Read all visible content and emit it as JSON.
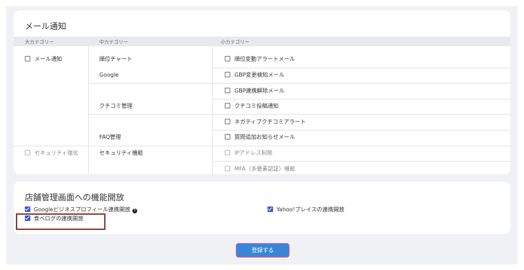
{
  "email_section": {
    "title": "メール通知",
    "headers": {
      "large": "大カテゴリー",
      "middle": "中カテゴリー",
      "small": "小カテゴリー"
    },
    "rows": [
      {
        "large": "メール通知",
        "middle": "順位チャート",
        "small": "順位変動アラートメール"
      },
      {
        "middle": "Google",
        "small": "GBP変更検知メール"
      },
      {
        "small": "GBP連携解除メール"
      },
      {
        "middle": "クチコミ管理",
        "small": "クチコミ投稿通知"
      },
      {
        "small": "ネガティブクチコミアラート"
      },
      {
        "middle": "FAQ管理",
        "small": "質問追加お知らせメール"
      },
      {
        "large": "セキュリティ強化",
        "middle": "セキュリティ機能",
        "small": "IPアドレス制限"
      },
      {
        "small": "MFA（多要素認証）機能"
      }
    ]
  },
  "store_section": {
    "title": "店舗管理画面への機能開放",
    "options": [
      {
        "label": "Googleビジネスプロフィール連携開放",
        "checked": true
      },
      {
        "label": "Yahoo!プレイスの連携開放",
        "checked": true
      },
      {
        "label": "食べログの連携開放",
        "checked": true
      }
    ]
  },
  "submit_label": "登録する"
}
